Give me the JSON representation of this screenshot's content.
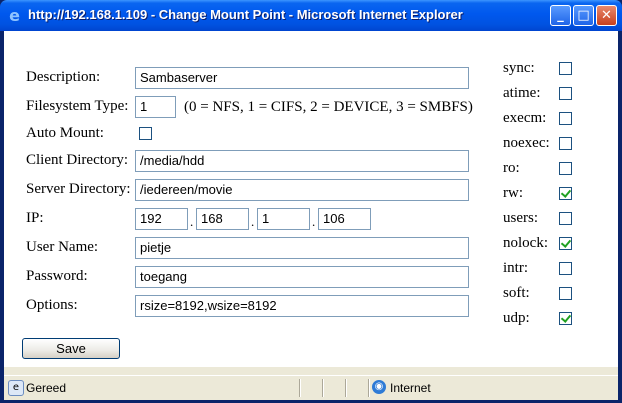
{
  "window": {
    "title": "http://192.168.1.109 - Change Mount Point - Microsoft Internet Explorer",
    "minimize_glyph": "_",
    "maximize_glyph": "□",
    "close_glyph": "✕"
  },
  "form": {
    "description": {
      "label": "Description:",
      "value": "Sambaserver"
    },
    "filesystem_type": {
      "label": "Filesystem Type:",
      "value": "1",
      "hint": "(0 = NFS, 1 = CIFS, 2 = DEVICE, 3 = SMBFS)"
    },
    "auto_mount": {
      "label": "Auto Mount:",
      "checked": false
    },
    "client_directory": {
      "label": "Client Directory:",
      "value": "/media/hdd"
    },
    "server_directory": {
      "label": "Server Directory:",
      "value": "/iedereen/movie"
    },
    "ip": {
      "label": "IP:",
      "octets": [
        "192",
        "168",
        "1",
        "106"
      ],
      "separator": "."
    },
    "user_name": {
      "label": "User Name:",
      "value": "pietje"
    },
    "password": {
      "label": "Password:",
      "value": "toegang"
    },
    "options": {
      "label": "Options:",
      "value": "rsize=8192,wsize=8192"
    },
    "save_label": "Save"
  },
  "mount_options": [
    {
      "label": "sync:",
      "checked": false
    },
    {
      "label": "atime:",
      "checked": false
    },
    {
      "label": "execm:",
      "checked": false
    },
    {
      "label": "noexec:",
      "checked": false
    },
    {
      "label": "ro:",
      "checked": false
    },
    {
      "label": "rw:",
      "checked": true
    },
    {
      "label": "users:",
      "checked": false
    },
    {
      "label": "nolock:",
      "checked": true
    },
    {
      "label": "intr:",
      "checked": false
    },
    {
      "label": "soft:",
      "checked": false
    },
    {
      "label": "udp:",
      "checked": true
    }
  ],
  "statusbar": {
    "status": "Gereed",
    "zone": "Internet"
  },
  "icons": {
    "app": "ie-icon",
    "page": "page-icon",
    "zone": "globe-icon"
  }
}
